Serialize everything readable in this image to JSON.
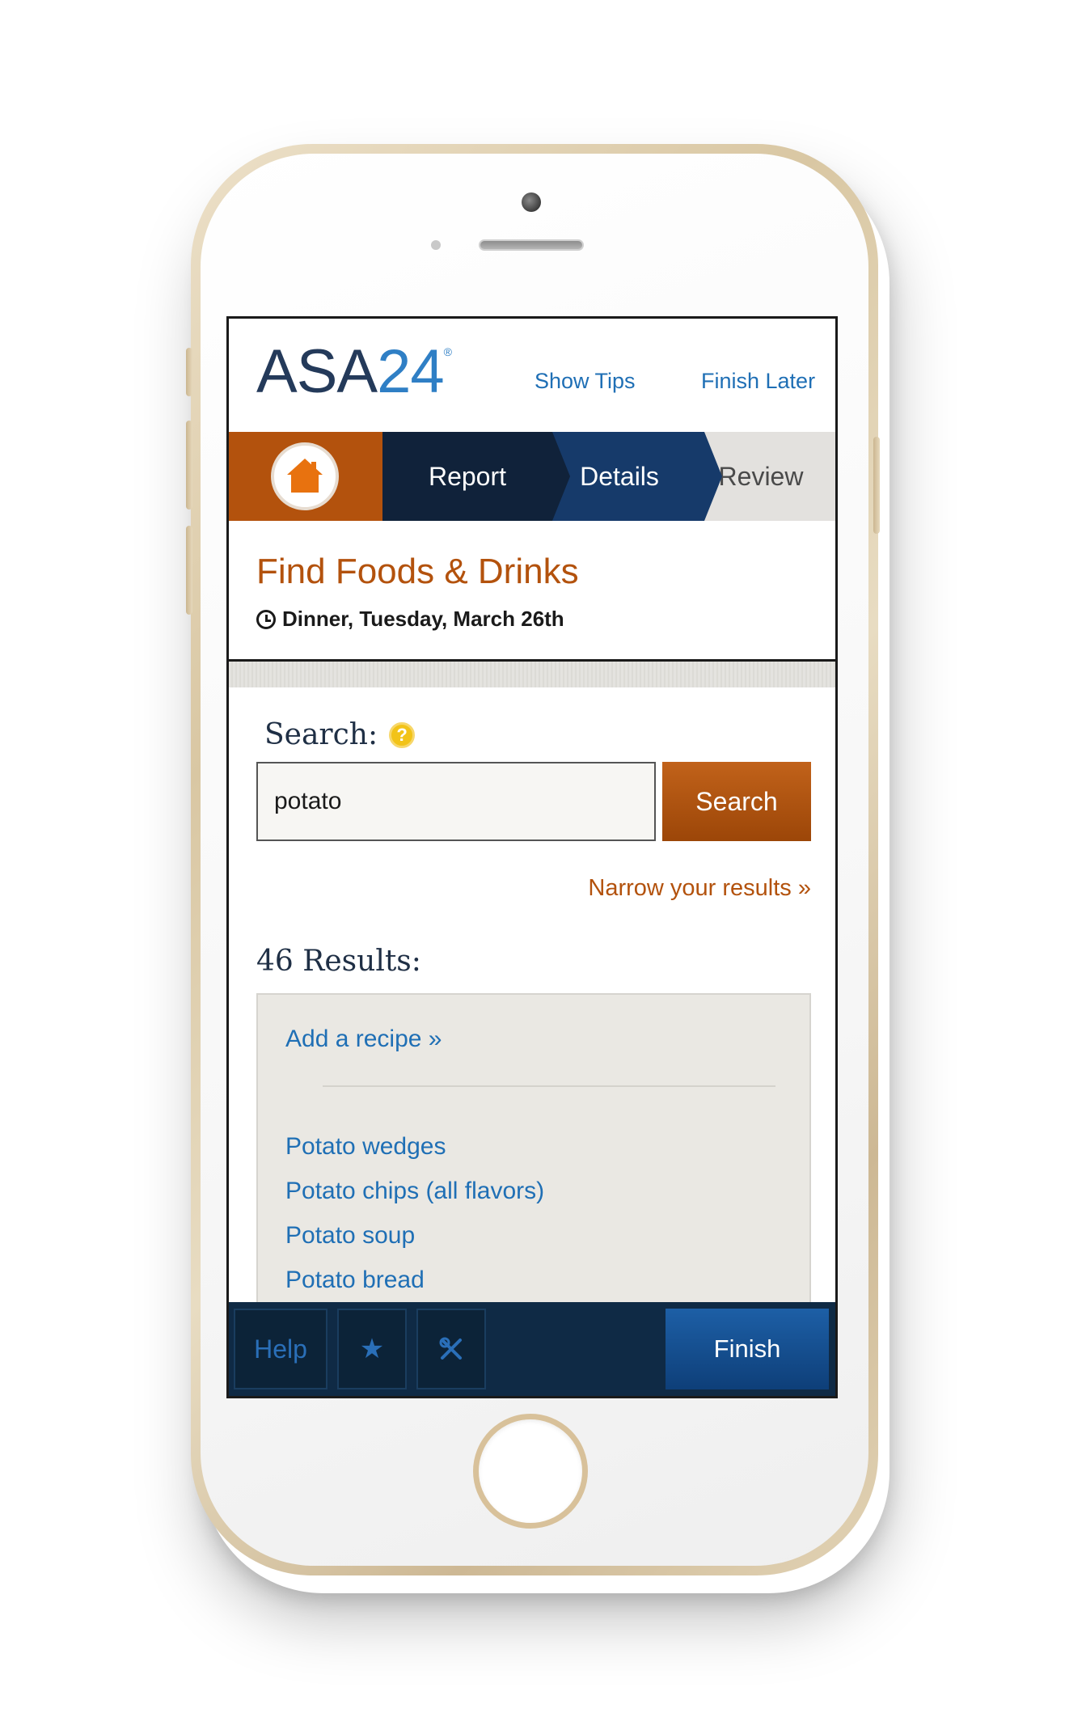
{
  "header": {
    "logo_letters": "ASA",
    "logo_digits": "24",
    "logo_reg": "®",
    "show_tips": "Show Tips",
    "finish_later": "Finish Later"
  },
  "progress": {
    "home_icon": "home-icon",
    "steps": [
      {
        "label": "Report",
        "state": "current"
      },
      {
        "label": "Details",
        "state": "upcoming"
      },
      {
        "label": "Review",
        "state": "upcoming"
      }
    ]
  },
  "title_block": {
    "title": "Find Foods & Drinks",
    "meal": "Dinner, Tuesday, March 26th",
    "meal_icon": "clock-icon"
  },
  "search": {
    "label": "Search:",
    "help_icon": "?",
    "value": "potato",
    "button": "Search",
    "narrow": "Narrow your results »"
  },
  "results": {
    "count_label": "46 Results:",
    "add_recipe": "Add a recipe »",
    "items": [
      "Potato wedges",
      "Potato chips (all flavors)",
      "Potato soup",
      "Potato bread"
    ]
  },
  "footer": {
    "help": "Help",
    "favorite_icon": "★",
    "tools_icon": "utensils-icon",
    "finish": "Finish"
  },
  "colors": {
    "brand_orange": "#b3520d",
    "navy": "#10223a",
    "link_blue": "#1f6fb5",
    "finish_blue": "#1d5fa6"
  }
}
